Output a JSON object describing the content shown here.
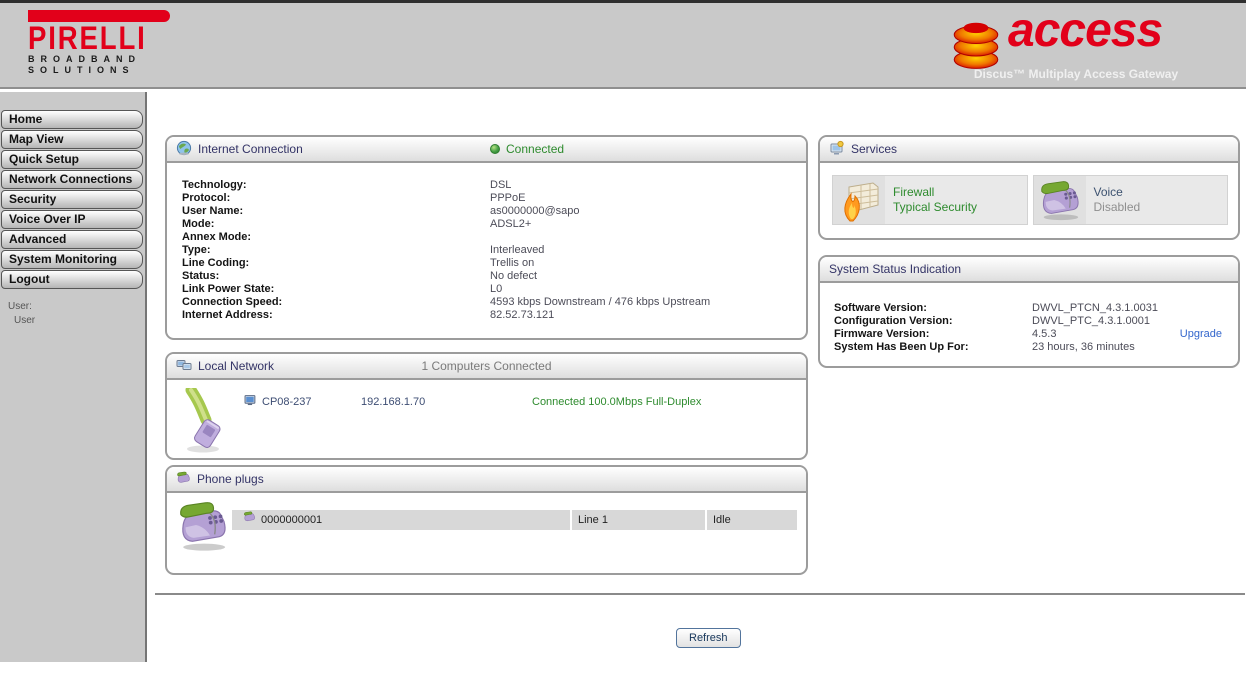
{
  "header": {
    "brand_logo": "PIRELLI",
    "brand_line1": "BROADBAND",
    "brand_line2": "SOLUTIONS",
    "product_logo": "access",
    "product_tagline": "Discus™ Multiplay Access Gateway"
  },
  "sidebar": {
    "items": [
      {
        "label": "Home"
      },
      {
        "label": "Map View"
      },
      {
        "label": "Quick Setup"
      },
      {
        "label": "Network Connections"
      },
      {
        "label": "Security"
      },
      {
        "label": "Voice Over IP"
      },
      {
        "label": "Advanced"
      },
      {
        "label": "System Monitoring"
      },
      {
        "label": "Logout"
      }
    ],
    "user_label": "User:",
    "user_name": "User"
  },
  "internet": {
    "title": "Internet Connection",
    "status": "Connected",
    "rows": [
      {
        "label": "Technology:",
        "value": "DSL"
      },
      {
        "label": "Protocol:",
        "value": "PPPoE"
      },
      {
        "label": "User Name:",
        "value": "as0000000@sapo"
      },
      {
        "label": "Mode:",
        "value": "ADSL2+"
      },
      {
        "label": "Annex Mode:",
        "value": ""
      },
      {
        "label": "Type:",
        "value": "Interleaved"
      },
      {
        "label": "Line Coding:",
        "value": "Trellis on"
      },
      {
        "label": "Status:",
        "value": "No defect"
      },
      {
        "label": "Link Power State:",
        "value": "L0"
      },
      {
        "label": "Connection Speed:",
        "value": "4593 kbps Downstream / 476 kbps Upstream"
      },
      {
        "label": "Internet Address:",
        "value": "82.52.73.121"
      }
    ]
  },
  "services": {
    "title": "Services",
    "items": [
      {
        "name": "Firewall",
        "status": "Typical Security"
      },
      {
        "name": "Voice",
        "status": "Disabled"
      }
    ]
  },
  "system_status": {
    "title": "System Status Indication",
    "rows": [
      {
        "label": "Software Version:",
        "value": "DWVL_PTCN_4.3.1.0031"
      },
      {
        "label": "Configuration Version:",
        "value": "DWVL_PTC_4.3.1.0001"
      },
      {
        "label": "Firmware Version:",
        "value": "4.5.3"
      },
      {
        "label": "System Has Been Up For:",
        "value": "23 hours, 36 minutes"
      }
    ],
    "upgrade_link": "Upgrade"
  },
  "local_network": {
    "title": "Local Network",
    "summary": "1 Computers Connected",
    "computers": [
      {
        "name": "CP08-237",
        "ip": "192.168.1.70",
        "status": "Connected 100.0Mbps Full-Duplex"
      }
    ]
  },
  "phone_plugs": {
    "title": "Phone plugs",
    "rows": [
      {
        "number": "0000000001",
        "line": "Line 1",
        "state": "Idle"
      }
    ]
  },
  "footer": {
    "refresh_label": "Refresh"
  },
  "colors": {
    "brand_red": "#e2001a",
    "header_gray": "#c9c9c9",
    "title_navy": "#333366",
    "status_green": "#2e8b2e",
    "link_blue": "#3366cc",
    "disabled_gray": "#8f8f8f"
  }
}
